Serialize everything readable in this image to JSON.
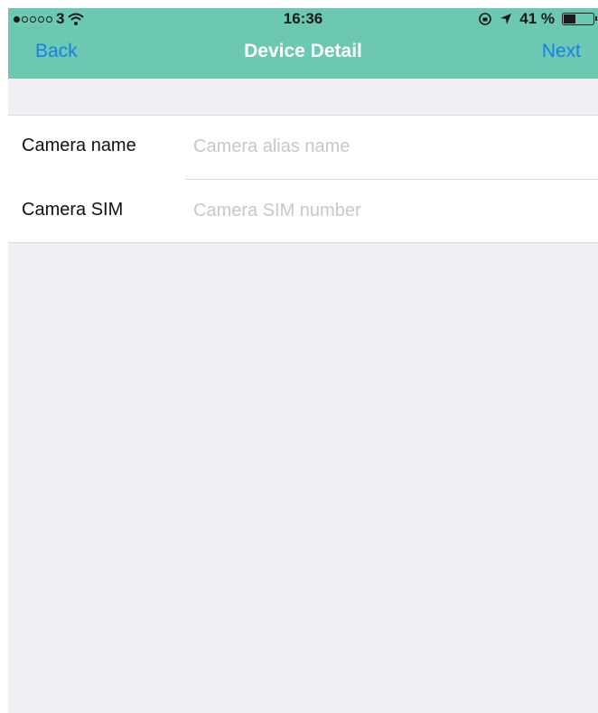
{
  "status_bar": {
    "carrier": "3",
    "signal_total": 5,
    "signal_filled": 1,
    "time": "16:36",
    "battery_percent": "41 %",
    "battery_level": 0.41
  },
  "nav_bar": {
    "back_label": "Back",
    "title": "Device Detail",
    "next_label": "Next",
    "color": "#6cc8b0",
    "button_color": "#1a7fe6"
  },
  "form": {
    "camera_name": {
      "label": "Camera name",
      "value": "",
      "placeholder": "Camera alias name"
    },
    "camera_sim": {
      "label": "Camera SIM",
      "value": "",
      "placeholder": "Camera SIM number"
    }
  }
}
